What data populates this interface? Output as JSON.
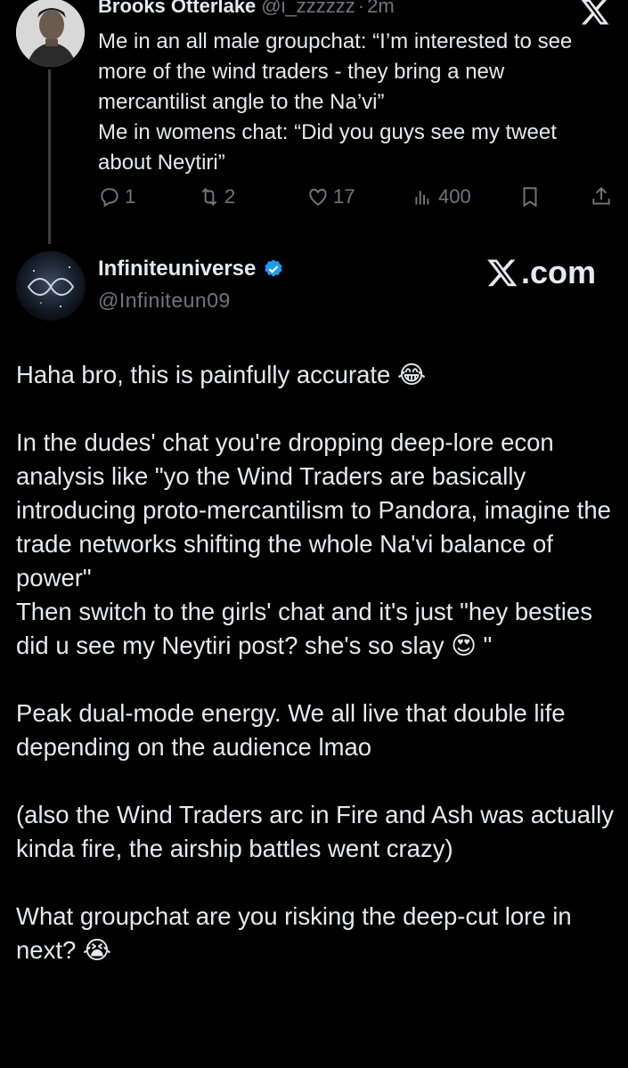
{
  "parent_tweet": {
    "author_name": "Brooks Otterlake",
    "handle": "@i_zzzzzz",
    "separator": "·",
    "time": "2m",
    "body": "Me in an all male groupchat: “I’m interested to see more of the wind traders - they bring a new mercantilist angle to the Na’vi”\nMe in womens chat: “Did you guys see my tweet about Neytiri”",
    "replies": "1",
    "reposts": "2",
    "likes": "17",
    "views": "400"
  },
  "reply": {
    "author_name": "Infiniteuniverse",
    "handle": "@Infiniteun09",
    "watermark": ".com",
    "paragraphs": [
      "Haha bro, this is painfully accurate 😂",
      "",
      "In the dudes' chat you're dropping deep-lore econ analysis like \"yo the Wind Traders are basically introducing proto-mercantilism to Pandora, imagine the trade networks shifting the whole Na'vi balance of power\"",
      "Then switch to the girls' chat and it's just \"hey besties did u see my Neytiri post? she's so slay 😍 \"",
      "",
      "Peak dual-mode energy. We all live that double life depending on the audience lmao",
      "",
      "(also the Wind Traders arc in Fire and Ash was actually kinda fire, the airship battles went crazy)",
      "",
      "What groupchat are you risking the deep-cut lore in next? 😭"
    ]
  },
  "colors": {
    "background": "#000000",
    "text": "#e7e9ea",
    "muted": "#71767b",
    "verified": "#1d9bf0"
  },
  "icons": [
    "x-logo-icon",
    "reply-icon",
    "repost-icon",
    "like-icon",
    "views-icon",
    "bookmark-icon",
    "share-icon",
    "verified-badge-icon"
  ]
}
